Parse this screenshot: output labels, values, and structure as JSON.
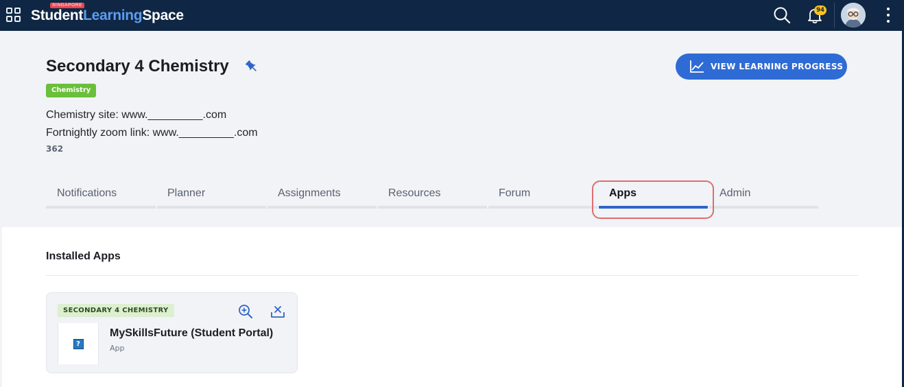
{
  "topbar": {
    "brand_country": "SINGAPORE",
    "brand_word1": "Student",
    "brand_word2": "Learning",
    "brand_word3": "Space",
    "notification_count": "94"
  },
  "course": {
    "title": "Secondary 4 Chemistry",
    "subject_tag": "Chemistry",
    "description_line1": "Chemistry site: www._________.com",
    "description_line2": "Fortnightly zoom link: www._________.com",
    "code": "362",
    "progress_button_label": "VIEW LEARNING PROGRESS"
  },
  "tabs": [
    {
      "label": "Notifications",
      "active": false
    },
    {
      "label": "Planner",
      "active": false
    },
    {
      "label": "Assignments",
      "active": false
    },
    {
      "label": "Resources",
      "active": false
    },
    {
      "label": "Forum",
      "active": false
    },
    {
      "label": "Apps",
      "active": true
    },
    {
      "label": "Admin",
      "active": false
    }
  ],
  "installed_apps": {
    "section_title": "Installed Apps",
    "items": [
      {
        "course_tag": "SECONDARY 4 CHEMISTRY",
        "name": "MySkillsFuture (Student Portal)",
        "type": "App",
        "thumbnail_glyph": "?"
      }
    ]
  },
  "colors": {
    "topbar_bg": "#0f2744",
    "brand_accent": "#5d9cf1",
    "primary_button": "#2e6bd5",
    "subject_tag": "#6abf3b",
    "active_tab_underline": "#2e63c9",
    "highlight_ring": "#de6d70",
    "notification_badge": "#f7c325"
  }
}
